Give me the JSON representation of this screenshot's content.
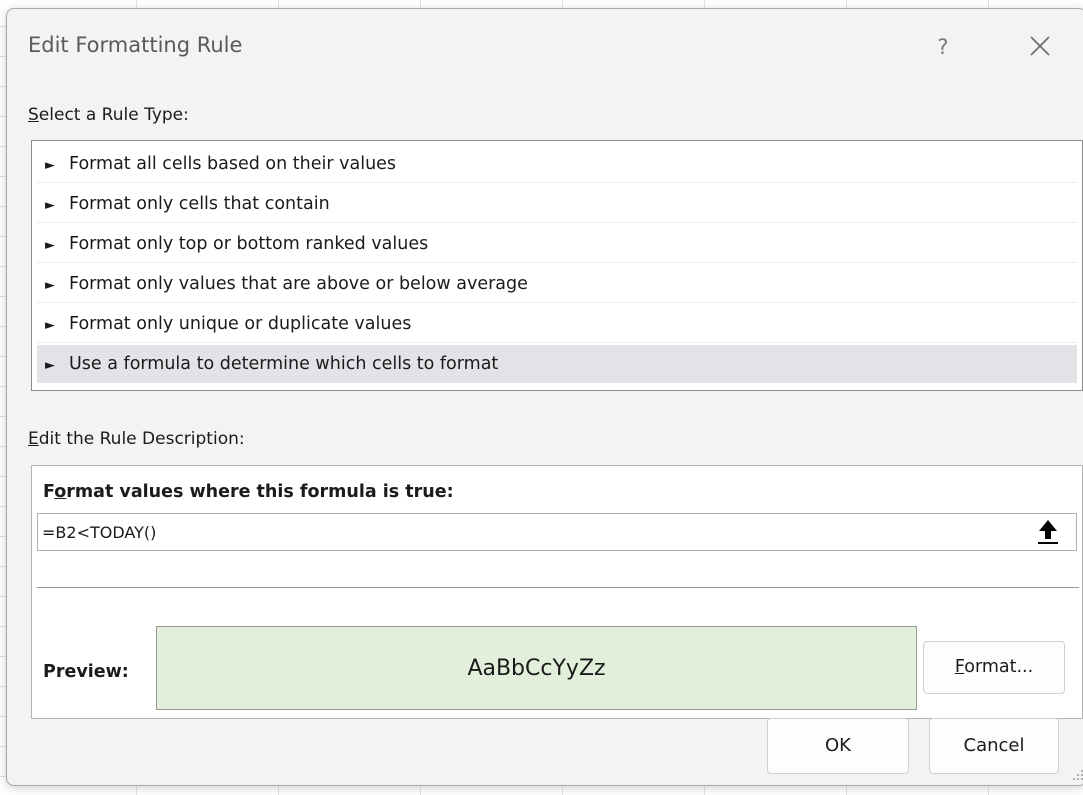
{
  "dialog": {
    "title": "Edit Formatting Rule",
    "help_label": "?",
    "close_label": "close"
  },
  "rule_type": {
    "label_accel": "S",
    "label_rest": "elect a Rule Type:",
    "items": [
      {
        "label": "Format all cells based on their values"
      },
      {
        "label": "Format only cells that contain"
      },
      {
        "label": "Format only top or bottom ranked values"
      },
      {
        "label": "Format only values that are above or below average"
      },
      {
        "label": "Format only unique or duplicate values"
      },
      {
        "label": "Use a formula to determine which cells to format"
      }
    ],
    "selected_index": 5
  },
  "description": {
    "label_accel": "E",
    "label_rest": "dit the Rule Description:",
    "formula_heading_pre": "F",
    "formula_heading_accel": "o",
    "formula_heading_rest": "rmat values where this formula is true:",
    "formula_value": "=B2<TODAY()",
    "preview_label": "Preview:",
    "preview_text": "AaBbCcYyZz",
    "preview_fill": "#e2efda",
    "format_accel": "F",
    "format_rest": "ormat..."
  },
  "buttons": {
    "ok": "OK",
    "cancel": "Cancel"
  },
  "icons": {
    "arrow": "right-pointer-icon",
    "collapse": "up-arrow-icon",
    "close": "close-icon",
    "grip": "resize-grip-icon"
  }
}
